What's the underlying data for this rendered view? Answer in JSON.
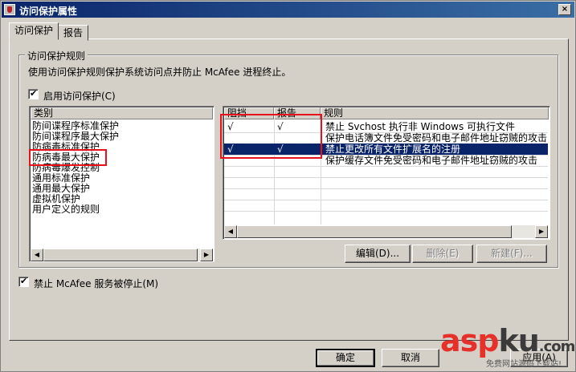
{
  "window": {
    "title": "访问保护属性",
    "close_glyph": "×"
  },
  "tabs": [
    {
      "label": "访问保护",
      "active": true
    },
    {
      "label": "报告",
      "active": false
    }
  ],
  "group": {
    "legend": "访问保护规则",
    "description": "使用访问保护规则保护系统访问点并防止 McAfee 进程终止。"
  },
  "enable_checkbox": {
    "label": "启用访问保护(C)",
    "checked": true
  },
  "category_list": {
    "header": "类别",
    "items": [
      "防间谍程序标准保护",
      "防间谍程序最大保护",
      "防病毒标准保护",
      "防病毒最大保护",
      "防病毒爆发控制",
      "通用标准保护",
      "通用最大保护",
      "虚拟机保护",
      "用户定义的规则"
    ],
    "selected_index": 3
  },
  "rules_table": {
    "columns": [
      "阻挡",
      "报告",
      "规则"
    ],
    "rows": [
      {
        "block": "√",
        "report": "√",
        "rule": "禁止 Svchost 执行非 Windows 可执行文件",
        "selected": false
      },
      {
        "block": "",
        "report": "",
        "rule": "保护电话簿文件免受密码和电子邮件地址窃贼的攻击",
        "selected": false
      },
      {
        "block": "√",
        "report": "√",
        "rule": "禁止更改所有文件扩展名的注册",
        "selected": true
      },
      {
        "block": "",
        "report": "",
        "rule": "保护缓存文件免受密码和电子邮件地址窃贼的攻击",
        "selected": false
      }
    ]
  },
  "rule_buttons": {
    "edit": "编辑(D)...",
    "delete": "删除(E)",
    "new": "新建(F)..."
  },
  "service_checkbox": {
    "label": "禁止 McAfee 服务被停止(M)",
    "checked": true
  },
  "dialog_buttons": {
    "ok": "确定",
    "cancel": "取消",
    "apply": "应用(A)"
  },
  "scroll_glyphs": {
    "left": "◀",
    "right": "▶"
  },
  "watermark": {
    "part1": "asp",
    "part2": "ku",
    "suffix": ".com",
    "subtitle": "免费网站源码下载站!"
  },
  "colors": {
    "annotation_red": "#e8101b",
    "selection": "#0a246a",
    "title_bar": "#0a246a"
  }
}
